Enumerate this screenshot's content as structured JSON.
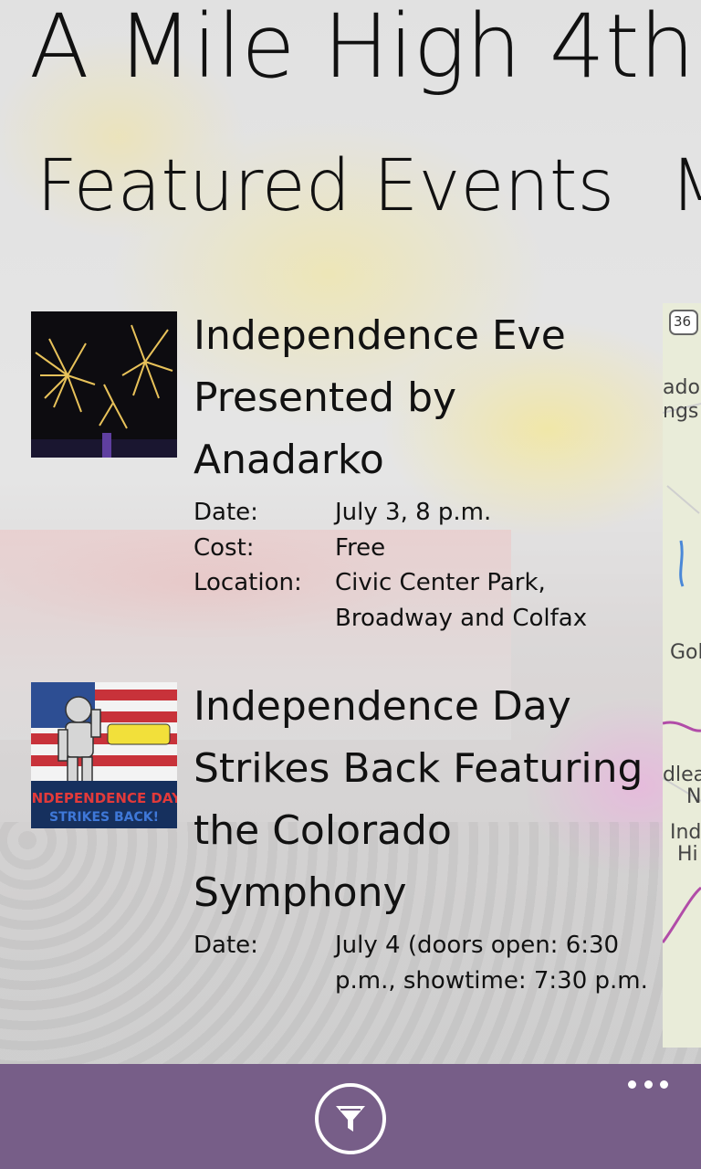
{
  "app": {
    "title": "A Mile High 4th"
  },
  "pivot": {
    "current": "Featured Events",
    "next_peek": "M"
  },
  "events": [
    {
      "title": "Independence Eve Presented by Anadarko",
      "date_label": "Date:",
      "date": "July 3, 8 p.m.",
      "cost_label": "Cost:",
      "cost": "Free",
      "location_label": "Location:",
      "location": "Civic Center Park, Broadway and Colfax"
    },
    {
      "title": "Independence Day Strikes Back Featuring the Colorado Symphony",
      "date_label": "Date:",
      "date": "July 4 (doors open: 6:30 p.m., showtime: 7:30 p.m.",
      "poster_text": "INDEPENDENCE DAY",
      "poster_subtext": "STRIKES BACK!"
    }
  ],
  "map_labels": {
    "highway": "36",
    "l1": "ado",
    "l2": "ngs",
    "l3": "Gol",
    "l4": "dlea",
    "l5": "N",
    "l6": "Ind",
    "l7": "Hi"
  },
  "appbar": {
    "filter_icon": "filter-icon",
    "more_icon": "more-icon"
  },
  "colors": {
    "appbar": "#775e88"
  }
}
